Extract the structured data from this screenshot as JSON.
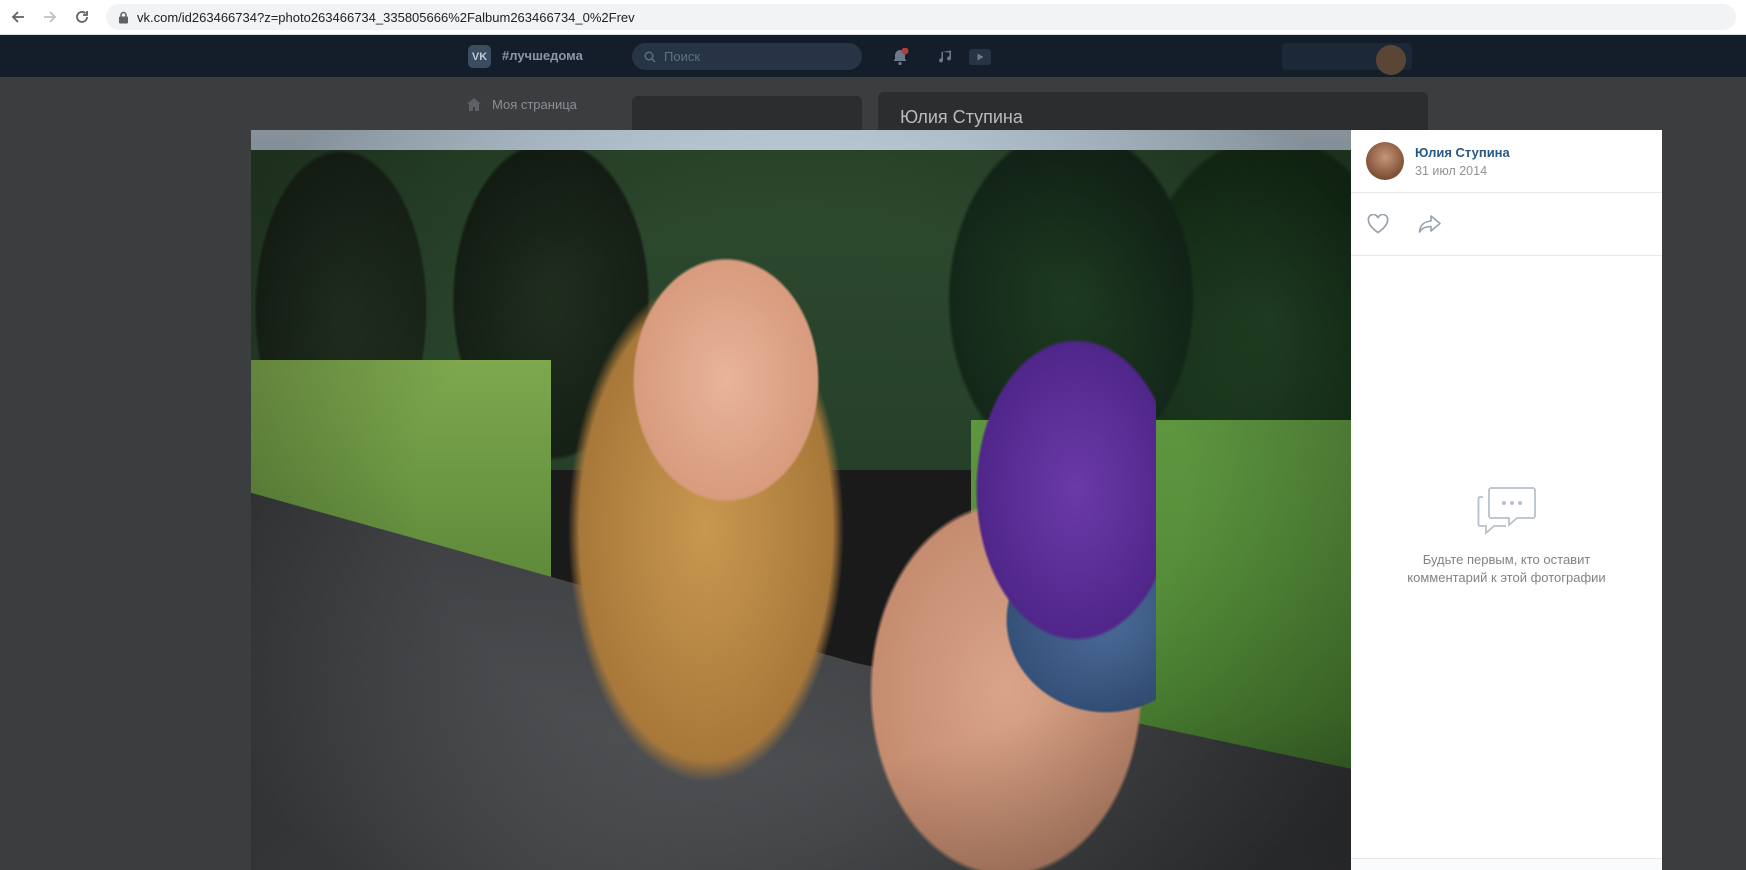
{
  "browser": {
    "url": "vk.com/id263466734?z=photo263466734_335805666%2Falbum263466734_0%2Frev",
    "back_icon": "arrow-left-icon",
    "forward_icon": "arrow-right-icon",
    "reload_icon": "reload-icon",
    "lock_icon": "lock-icon"
  },
  "vk_header": {
    "logo": "VK",
    "hashtag": "#лучшедома",
    "search_placeholder": "Поиск",
    "notification_badge": "1"
  },
  "vk_sidebar": {
    "my_page": "Моя страница"
  },
  "vk_profile": {
    "name": "Юлия Ступина"
  },
  "photo_viewer": {
    "author_name": "Юлия Ступина",
    "date": "31 июл 2014",
    "like_icon": "heart-icon",
    "share_icon": "share-icon",
    "empty_comments_line1": "Будьте первым, кто оставит",
    "empty_comments_line2": "комментарий к этой фотографии"
  },
  "colors": {
    "vk_header_bg": "#141e2a",
    "overlay_bg": "#3b3d3f",
    "author_link": "#2a5885",
    "muted_text": "#939393"
  }
}
